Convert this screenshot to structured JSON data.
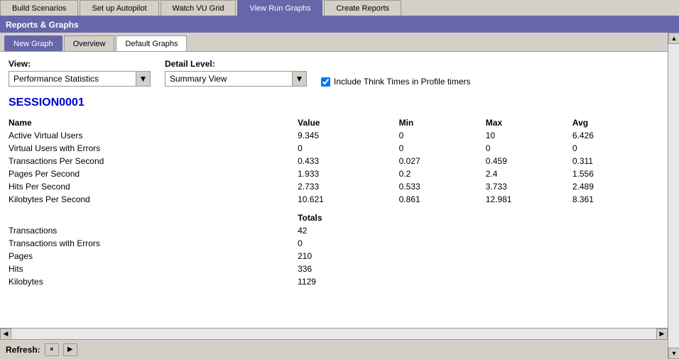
{
  "topTabs": {
    "items": [
      {
        "id": "build-scenarios",
        "label": "Build Scenarios",
        "active": false
      },
      {
        "id": "set-up-autopilot",
        "label": "Set up Autopilot",
        "active": false
      },
      {
        "id": "watch-vu-grid",
        "label": "Watch VU Grid",
        "active": false
      },
      {
        "id": "view-run-graphs",
        "label": "View Run Graphs",
        "active": true
      },
      {
        "id": "create-reports",
        "label": "Create Reports",
        "active": false
      }
    ]
  },
  "panel": {
    "title": "Reports & Graphs",
    "subTabs": [
      {
        "id": "new-graph",
        "label": "New Graph",
        "style": "btn"
      },
      {
        "id": "overview",
        "label": "Overview",
        "active": false
      },
      {
        "id": "default-graphs",
        "label": "Default Graphs",
        "active": true
      }
    ]
  },
  "controls": {
    "viewLabel": "View:",
    "viewValue": "Performance Statistics",
    "detailLabel": "Detail Level:",
    "detailValue": "Summary View",
    "checkboxLabel": "Include Think Times in Profile timers",
    "checkboxChecked": true
  },
  "session": {
    "id": "SESSION0001",
    "columns": [
      "Name",
      "Value",
      "Min",
      "Max",
      "Avg"
    ],
    "rows": [
      {
        "name": "Active Virtual Users",
        "value": "9.345",
        "min": "0",
        "max": "10",
        "avg": "6.426"
      },
      {
        "name": "Virtual Users with Errors",
        "value": "0",
        "min": "0",
        "max": "0",
        "avg": "0"
      },
      {
        "name": "Transactions Per Second",
        "value": "0.433",
        "min": "0.027",
        "max": "0.459",
        "avg": "0.311"
      },
      {
        "name": "Pages Per Second",
        "value": "1.933",
        "min": "0.2",
        "max": "2.4",
        "avg": "1.556"
      },
      {
        "name": "Hits Per Second",
        "value": "2.733",
        "min": "0.533",
        "max": "3.733",
        "avg": "2.489"
      },
      {
        "name": "Kilobytes Per Second",
        "value": "10.621",
        "min": "0.861",
        "max": "12.981",
        "avg": "8.361"
      }
    ],
    "totalsHeader": "Totals",
    "totals": [
      {
        "name": "Transactions",
        "value": "42"
      },
      {
        "name": "Transactions with Errors",
        "value": "0"
      },
      {
        "name": "Pages",
        "value": "210"
      },
      {
        "name": "Hits",
        "value": "336"
      },
      {
        "name": "Kilobytes",
        "value": "1129"
      }
    ]
  },
  "refresh": {
    "label": "Refresh:",
    "pauseIcon": "⏸",
    "playIcon": "▶"
  }
}
